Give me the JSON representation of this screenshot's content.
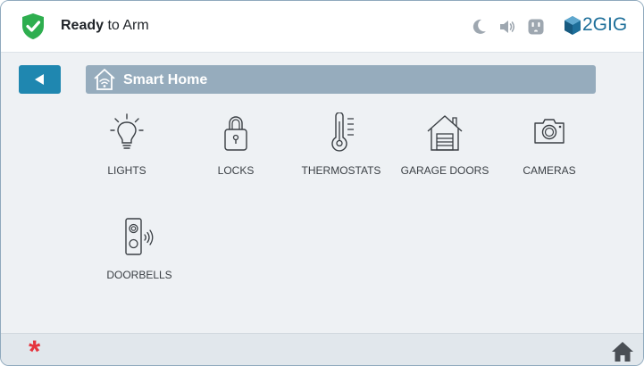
{
  "status": {
    "bold": "Ready",
    "rest": " to Arm",
    "color": "#2eae4f"
  },
  "topbar_icons": [
    "moon-icon",
    "speaker-icon",
    "outlet-icon"
  ],
  "brand": {
    "name": "2GIG",
    "color": "#1e6f9a"
  },
  "nav": {
    "back_icon": "left-triangle-icon"
  },
  "header": {
    "title": "Smart Home",
    "icon": "smart-home-icon"
  },
  "tiles": [
    {
      "label": "LIGHTS",
      "icon": "lightbulb-icon"
    },
    {
      "label": "LOCKS",
      "icon": "padlock-icon"
    },
    {
      "label": "THERMOSTATS",
      "icon": "thermometer-icon"
    },
    {
      "label": "GARAGE DOORS",
      "icon": "garage-icon"
    },
    {
      "label": "CAMERAS",
      "icon": "camera-icon"
    },
    {
      "label": "DOORBELLS",
      "icon": "doorbell-icon"
    }
  ],
  "footer": {
    "asterisk": "*",
    "asterisk_color": "#e5343d",
    "home_icon": "house-icon"
  }
}
